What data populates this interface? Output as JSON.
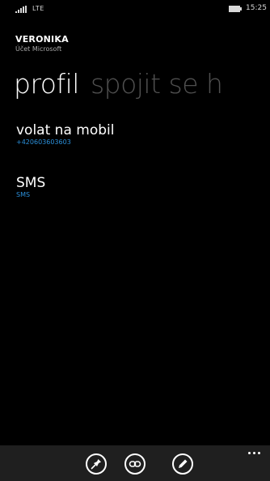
{
  "status_bar": {
    "network": "LTE",
    "time": "15:25",
    "icons": [
      "signal-icon",
      "battery-icon"
    ]
  },
  "account": {
    "name": "VERONIKA",
    "type": "Účet Microsoft"
  },
  "pivot": {
    "active": "profil",
    "next": "spojit se h"
  },
  "actions": [
    {
      "title": "volat na mobil",
      "subtitle": "+420603603603"
    },
    {
      "title": "SMS",
      "subtitle": "SMS"
    }
  ],
  "app_bar": {
    "buttons": [
      "pin-icon",
      "link-icon",
      "edit-icon"
    ],
    "more": "more-icon"
  },
  "colors": {
    "accent": "#2b8fd9",
    "background": "#000000",
    "app_bar": "#1f1f1f",
    "inactive_pivot": "#505050"
  }
}
